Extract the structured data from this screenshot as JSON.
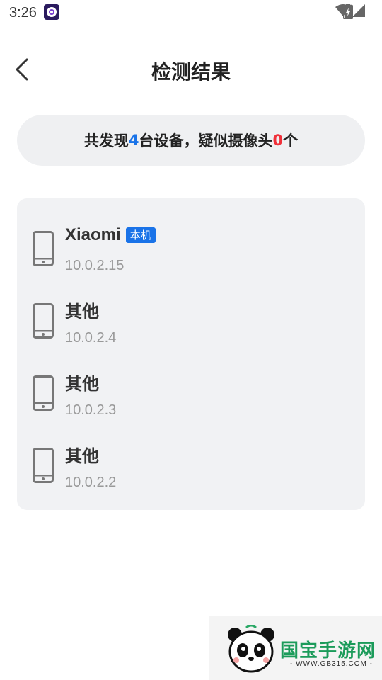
{
  "status_bar": {
    "time": "3:26"
  },
  "header": {
    "title": "检测结果"
  },
  "summary": {
    "prefix": "共发现",
    "device_count": "4",
    "middle": "台设备，疑似摄像头",
    "camera_count": "0",
    "suffix": "个"
  },
  "devices": [
    {
      "name": "Xiaomi",
      "badge": "本机",
      "ip": "10.0.2.15"
    },
    {
      "name": "其他",
      "ip": "10.0.2.4"
    },
    {
      "name": "其他",
      "ip": "10.0.2.3"
    },
    {
      "name": "其他",
      "ip": "10.0.2.2"
    }
  ],
  "watermark": {
    "title": "国宝手游网",
    "url": "- WWW.GB315.COM -"
  },
  "colors": {
    "accent": "#1a73e8",
    "alert": "#f0303a",
    "card_bg": "#f1f2f4"
  }
}
